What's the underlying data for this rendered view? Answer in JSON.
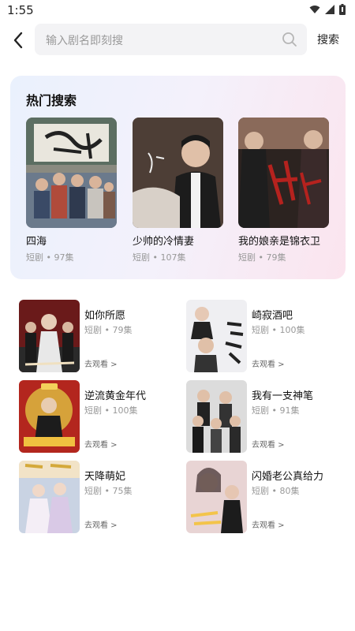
{
  "status_bar": {
    "time": "1:55",
    "icons": [
      "wifi-icon",
      "signal-icon",
      "battery-icon"
    ]
  },
  "search": {
    "placeholder": "输入剧名即刻搜",
    "button_label": "搜索"
  },
  "hot_search": {
    "title": "热门搜索",
    "items": [
      {
        "name": "四海",
        "meta": "短剧 • 97集"
      },
      {
        "name": "少帅的冷情妻",
        "meta": "短剧 • 107集"
      },
      {
        "name": "我的娘亲是锦衣卫",
        "meta": "短剧 • 79集"
      }
    ]
  },
  "list": {
    "items": [
      {
        "title": "如你所愿",
        "meta": "短剧 • 79集",
        "link": "去观看 >"
      },
      {
        "title": "崎寂酒吧",
        "meta": "短剧 • 100集",
        "link": "去观看 >"
      },
      {
        "title": "逆流黄金年代",
        "meta": "短剧 • 100集",
        "link": "去观看 >"
      },
      {
        "title": "我有一支神笔",
        "meta": "短剧 • 91集",
        "link": "去观看 >"
      },
      {
        "title": "天降萌妃",
        "meta": "短剧 • 75集",
        "link": "去观看 >"
      },
      {
        "title": "闪婚老公真给力",
        "meta": "短剧 • 80集",
        "link": "去观看 >"
      }
    ]
  },
  "colors": {
    "accent_gradient_start": "#eaf1fd",
    "accent_gradient_end": "#fbe4ee",
    "meta_text": "#999999"
  }
}
